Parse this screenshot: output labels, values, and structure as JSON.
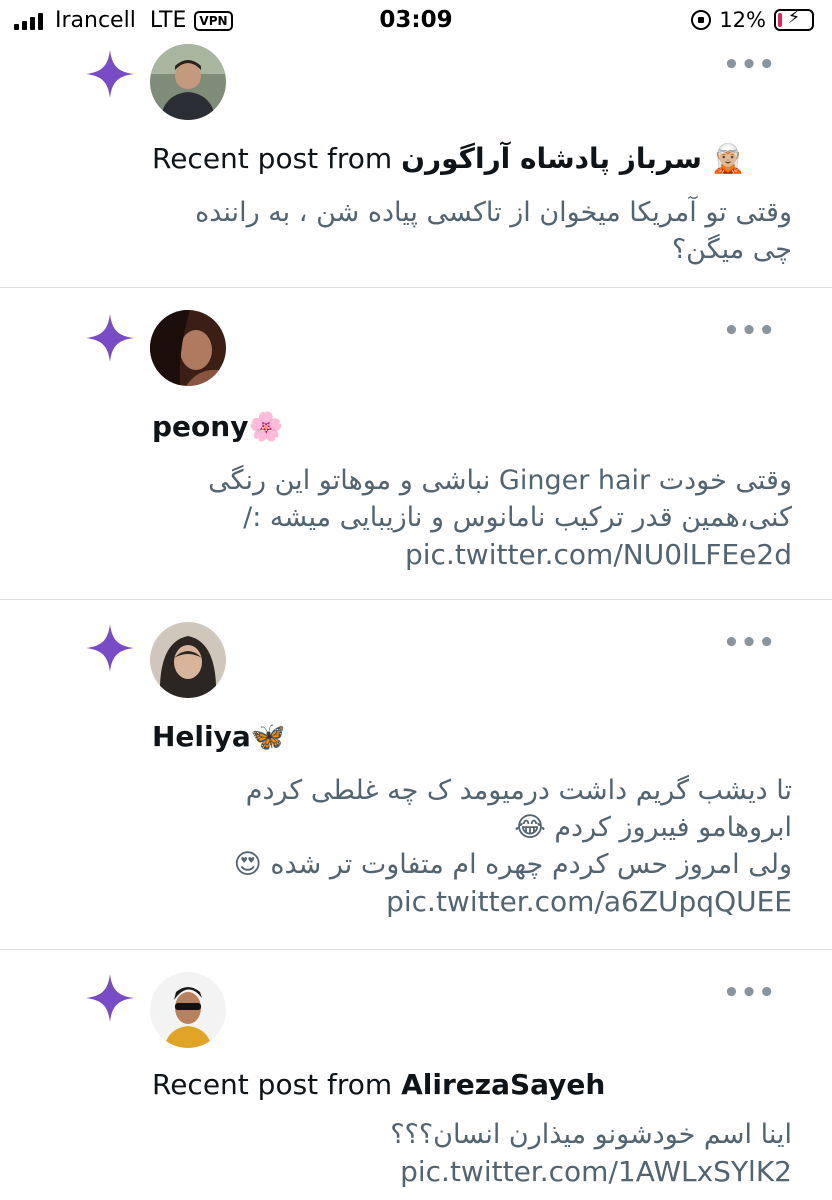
{
  "status_bar": {
    "carrier": "Irancell",
    "network": "LTE",
    "vpn": "VPN",
    "time": "03:09",
    "battery": "12%",
    "battery_level": 0.12
  },
  "feed": [
    {
      "prefix": "Recent post from",
      "name": "سرباز پادشاه آراگورن",
      "name_emoji": "🧝🏼",
      "body": [
        "وقتی تو آمریکا میخوان از تاکسی پیاده شن ، به راننده",
        "چی میگن؟"
      ],
      "link": ""
    },
    {
      "prefix": "",
      "name": "peony",
      "name_emoji": "🌸",
      "body": [
        "وقتی خودت Ginger hair نباشی و موهاتو این رنگی",
        "کنی،همین قدر ترکیب نامانوس و نازیبایی میشه :/"
      ],
      "link": "pic.twitter.com/NU0lLFEe2d"
    },
    {
      "prefix": "",
      "name": "Heliya",
      "name_emoji": "🦋",
      "body": [
        "تا دیشب گریم داشت درمیومد ک چه غلطی کردم",
        "ابروهامو فیبروز کردم 😂",
        "ولی امروز حس کردم چهره ام متفاوت تر شده 😍"
      ],
      "link": "pic.twitter.com/a6ZUpqQUEE"
    },
    {
      "prefix": "Recent post from",
      "name": "AlirezaSayeh",
      "name_emoji": "",
      "body": [
        "اینا اسم خودشونو میذارن انسان؟؟؟"
      ],
      "link": "pic.twitter.com/1AWLxSYlK2"
    }
  ],
  "ui": {
    "more_glyph": "•••",
    "accent_color": "#794bc4",
    "text_color": "#0f1419",
    "secondary_text_color": "#536471"
  },
  "icons": [
    "signal-icon",
    "lock-rotation-icon",
    "battery-icon",
    "sparkle-icon",
    "more-icon"
  ]
}
